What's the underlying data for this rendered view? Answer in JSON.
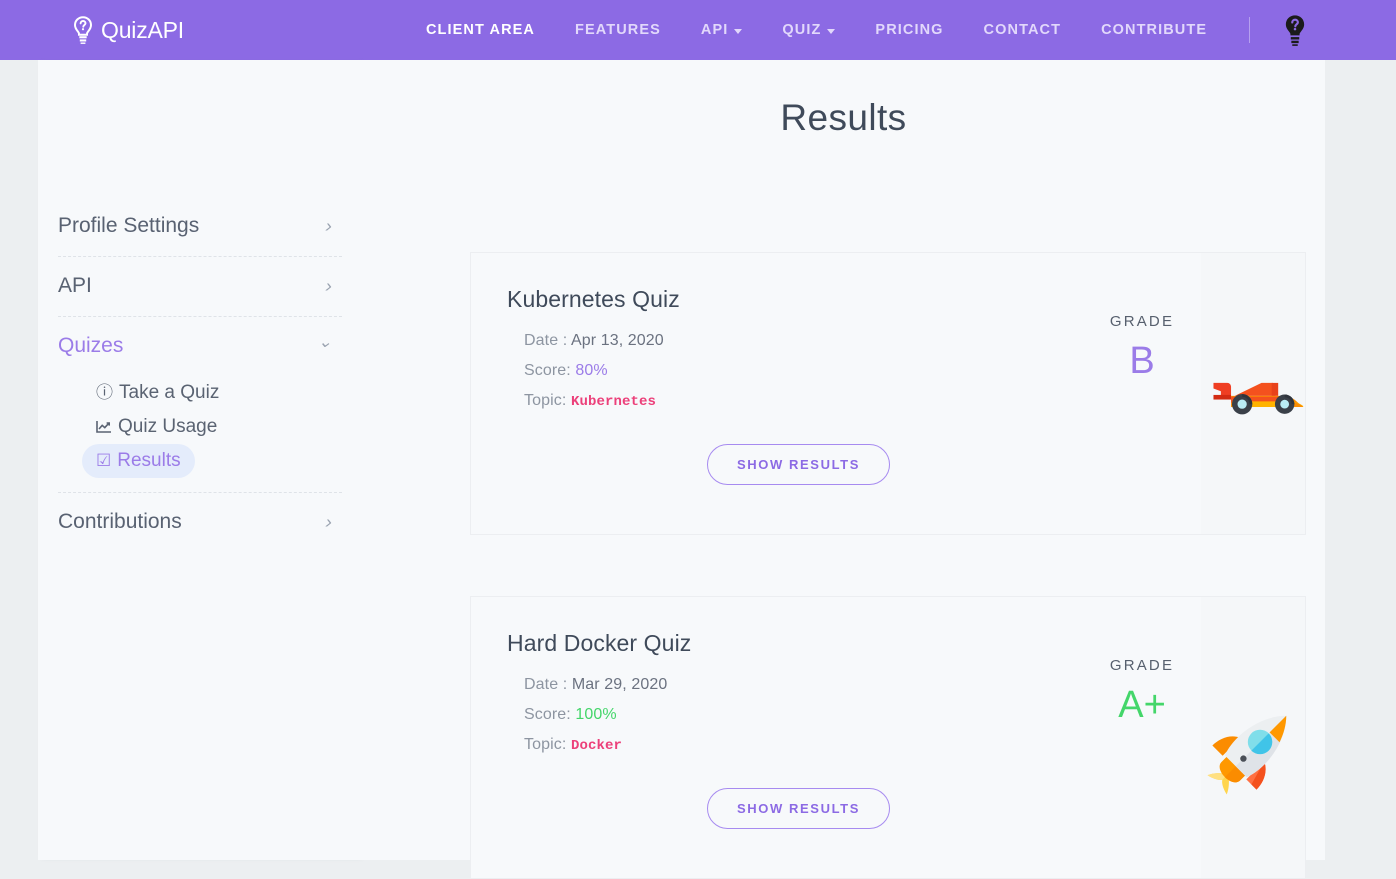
{
  "navbar": {
    "brand": "QuizAPI",
    "brand_icon": "lightbulb-question-icon",
    "help_icon": "lightbulb-question-dark-icon",
    "background": "#8c6ae4",
    "links": [
      {
        "label": "CLIENT AREA",
        "active": true,
        "caret": false
      },
      {
        "label": "FEATURES",
        "active": false,
        "caret": false
      },
      {
        "label": "API",
        "active": false,
        "caret": true
      },
      {
        "label": "QUIZ",
        "active": false,
        "caret": true
      },
      {
        "label": "PRICING",
        "active": false,
        "caret": false
      },
      {
        "label": "CONTACT",
        "active": false,
        "caret": false
      },
      {
        "label": "CONTRIBUTE",
        "active": false,
        "caret": false
      }
    ]
  },
  "sidebar": {
    "groups": [
      {
        "label": "Profile Settings",
        "expanded": false,
        "chevron": "chevron-right-icon"
      },
      {
        "label": "API",
        "expanded": false,
        "chevron": "chevron-right-icon"
      },
      {
        "label": "Quizes",
        "expanded": true,
        "chevron": "chevron-down-icon",
        "items": [
          {
            "label": "Take a Quiz",
            "icon": "question-circle-icon",
            "glyph": "ⓘ",
            "selected": false
          },
          {
            "label": "Quiz Usage",
            "icon": "chart-line-icon",
            "glyph": "↗",
            "selected": false
          },
          {
            "label": "Results",
            "icon": "check-square-icon",
            "glyph": "☑",
            "selected": true
          }
        ]
      },
      {
        "label": "Contributions",
        "expanded": false,
        "chevron": "chevron-right-icon"
      }
    ]
  },
  "main": {
    "title": "Results",
    "grade_label": "GRADE",
    "button_label": "SHOW RESULTS",
    "date_prefix": "Date :",
    "score_prefix": "Score:",
    "topic_prefix": "Topic:",
    "results": [
      {
        "quiz_title": "Kubernetes Quiz",
        "date": "Apr 13, 2020",
        "score": "80%",
        "score_color": "#9b7ce8",
        "topic": "Kubernetes",
        "topic_color": "#ec407a",
        "grade": "B",
        "grade_color": "#9b7ce8",
        "art": "race-car-illustration"
      },
      {
        "quiz_title": "Hard Docker Quiz",
        "date": "Mar 29, 2020",
        "score": "100%",
        "score_color": "#44d66a",
        "topic": "Docker",
        "topic_color": "#ec407a",
        "grade": "A+",
        "grade_color": "#44d66a",
        "art": "rocket-illustration"
      }
    ]
  },
  "colors": {
    "brand_purple": "#8c6ae4",
    "accent_purple": "#9b7ce8",
    "pink": "#ec407a",
    "green": "#44d66a",
    "panel": "#f7f9fb",
    "page_bg": "#eceff1"
  }
}
